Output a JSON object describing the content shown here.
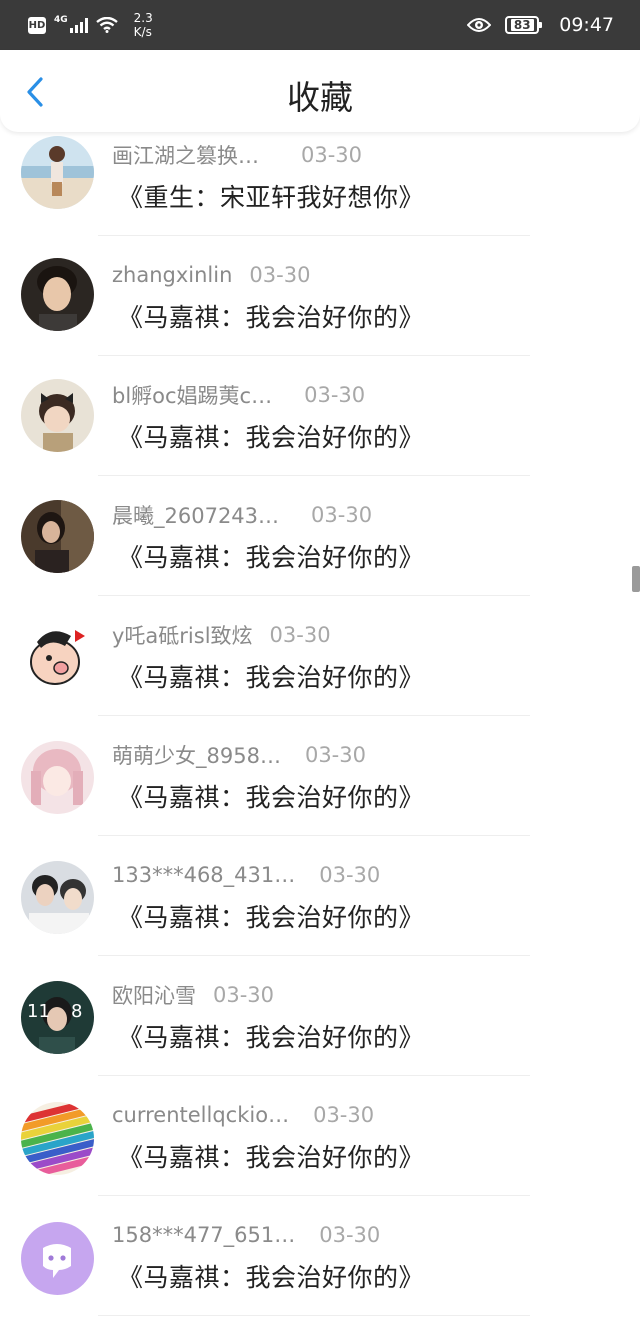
{
  "status_bar": {
    "hd": "HD",
    "network": "4G",
    "speed_value": "2.3",
    "speed_unit": "K/s",
    "battery": "83",
    "time": "09:47"
  },
  "header": {
    "title": "收藏"
  },
  "items": [
    {
      "name": "画江湖之篡换…",
      "date": "03-30",
      "title": "《重生：宋亚轩我好想你》"
    },
    {
      "name": "zhangxinlin",
      "date": "03-30",
      "title": "《马嘉祺：我会治好你的》"
    },
    {
      "name": "bl孵oc娼踢荑c…",
      "date": "03-30",
      "title": "《马嘉祺：我会治好你的》"
    },
    {
      "name": "晨曦_2607243…",
      "date": "03-30",
      "title": "《马嘉祺：我会治好你的》"
    },
    {
      "name": "y吒a砥risl致炫",
      "date": "03-30",
      "title": "《马嘉祺：我会治好你的》"
    },
    {
      "name": "萌萌少女_8958…",
      "date": "03-30",
      "title": "《马嘉祺：我会治好你的》"
    },
    {
      "name": "133***468_431…",
      "date": "03-30",
      "title": "《马嘉祺：我会治好你的》"
    },
    {
      "name": "欧阳沁雪",
      "date": "03-30",
      "title": "《马嘉祺：我会治好你的》"
    },
    {
      "name": "currentellqckio…",
      "date": "03-30",
      "title": "《马嘉祺：我会治好你的》"
    },
    {
      "name": "158***477_651…",
      "date": "03-30",
      "title": "《马嘉祺：我会治好你的》"
    }
  ]
}
